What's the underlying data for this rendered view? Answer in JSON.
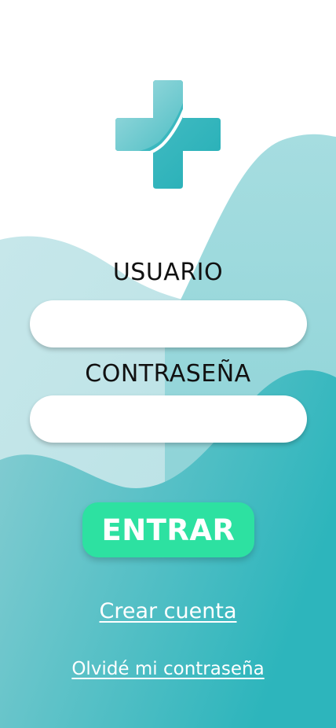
{
  "login": {
    "username_label": "USUARIO",
    "username_value": "",
    "password_label": "CONTRASEÑA",
    "password_value": "",
    "submit_label": "ENTRAR",
    "create_account_link": "Crear cuenta",
    "forgot_password_link": "Olvidé mi contraseña"
  },
  "icons": {
    "logo": "medical-cross-icon"
  },
  "colors": {
    "background": "#ffffff",
    "wave_light": "#bfe3e7",
    "wave_accent": "#3fb6bc",
    "button": "#2de1a1",
    "text_dark": "#111111",
    "link_text": "#ffffff"
  }
}
